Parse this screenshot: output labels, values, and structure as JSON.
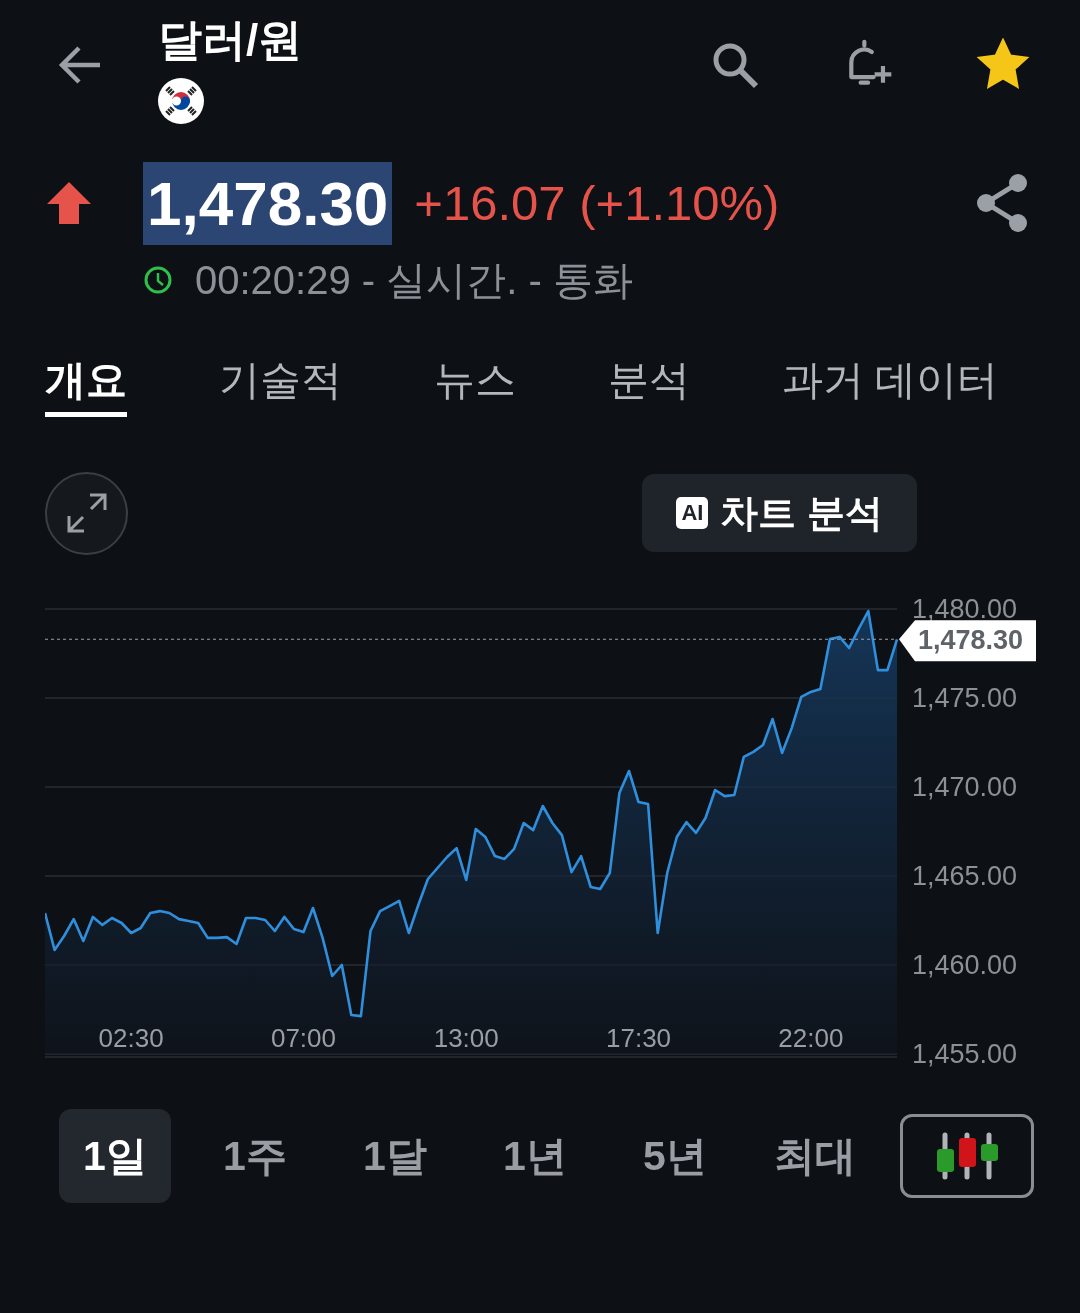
{
  "header": {
    "title": "달러/원",
    "starred": true
  },
  "quote": {
    "price": "1,478.30",
    "change": "+16.07 (+1.10%)",
    "time": "00:20:29 - 실시간. - 통화"
  },
  "tabs": [
    {
      "label": "개요",
      "selected": true
    },
    {
      "label": "기술적",
      "selected": false
    },
    {
      "label": "뉴스",
      "selected": false
    },
    {
      "label": "분석",
      "selected": false
    },
    {
      "label": "과거 데이터",
      "selected": false
    }
  ],
  "chart_tools": {
    "ai_badge": "AI",
    "analysis_button": "차트 분석"
  },
  "chart": {
    "chart_data": {
      "type": "area",
      "grid": true,
      "categories": [
        null,
        null,
        null,
        null,
        null,
        null,
        null,
        null,
        null,
        "02:30",
        null,
        null,
        null,
        null,
        null,
        null,
        null,
        null,
        null,
        null,
        null,
        null,
        null,
        null,
        null,
        null,
        null,
        "07:00",
        null,
        null,
        null,
        null,
        null,
        null,
        null,
        null,
        null,
        null,
        null,
        null,
        null,
        null,
        null,
        null,
        "13:00",
        null,
        null,
        null,
        null,
        null,
        null,
        null,
        null,
        null,
        null,
        null,
        null,
        null,
        null,
        null,
        null,
        null,
        "17:30",
        null,
        null,
        null,
        null,
        null,
        null,
        null,
        null,
        null,
        null,
        null,
        null,
        null,
        null,
        null,
        null,
        null,
        "22:00",
        null,
        null,
        null,
        null,
        null,
        null,
        null,
        null,
        null
      ],
      "series": [
        {
          "color": "#2f8fdd",
          "values": [
            1462.92,
            1460.84,
            1461.63,
            1462.58,
            1461.35,
            1462.7,
            1462.25,
            1462.64,
            1462.36,
            1461.8,
            1462.08,
            1462.92,
            1463.03,
            1462.92,
            1462.58,
            1462.47,
            1462.36,
            1461.52,
            1461.52,
            1461.57,
            1461.18,
            1462.64,
            1462.64,
            1462.53,
            1461.91,
            1462.7,
            1462.02,
            1461.85,
            1463.2,
            1461.52,
            1459.38,
            1460.0,
            1457.19,
            1457.13,
            1461.91,
            1463.03,
            1463.31,
            1463.6,
            1461.8,
            1463.37,
            1464.83,
            1465.45,
            1466.07,
            1466.57,
            1464.78,
            1467.64,
            1467.19,
            1466.12,
            1465.96,
            1466.52,
            1467.98,
            1467.58,
            1468.93,
            1467.98,
            1467.3,
            1465.22,
            1466.12,
            1464.38,
            1464.27,
            1465.17,
            1469.66,
            1470.9,
            1469.16,
            1469.04,
            1461.8,
            1465.17,
            1467.19,
            1468.03,
            1467.42,
            1468.26,
            1469.83,
            1469.49,
            1469.55,
            1471.69,
            1471.97,
            1472.36,
            1473.82,
            1471.91,
            1473.31,
            1475.06,
            1475.34,
            1475.51,
            1478.31,
            1478.43,
            1477.81,
            1478.88,
            1479.89,
            1476.57,
            1476.57,
            1478.3
          ]
        }
      ],
      "ylim": [
        1455,
        1480
      ],
      "yticks": [
        {
          "value": 1480,
          "label": "1,480.00"
        },
        {
          "value": 1475,
          "label": "1,475.00"
        },
        {
          "value": 1470,
          "label": "1,470.00"
        },
        {
          "value": 1465,
          "label": "1,465.00"
        },
        {
          "value": 1460,
          "label": "1,460.00"
        },
        {
          "value": 1455,
          "label": "1,455.00"
        }
      ],
      "ref_lines": [
        {
          "axis": "y",
          "value": 1478.3
        }
      ],
      "annotations": [
        "1,478.30"
      ]
    }
  },
  "ranges": [
    {
      "label": "1일",
      "selected": true
    },
    {
      "label": "1주",
      "selected": false
    },
    {
      "label": "1달",
      "selected": false
    },
    {
      "label": "1년",
      "selected": false
    },
    {
      "label": "5년",
      "selected": false
    },
    {
      "label": "최대",
      "selected": false
    }
  ]
}
